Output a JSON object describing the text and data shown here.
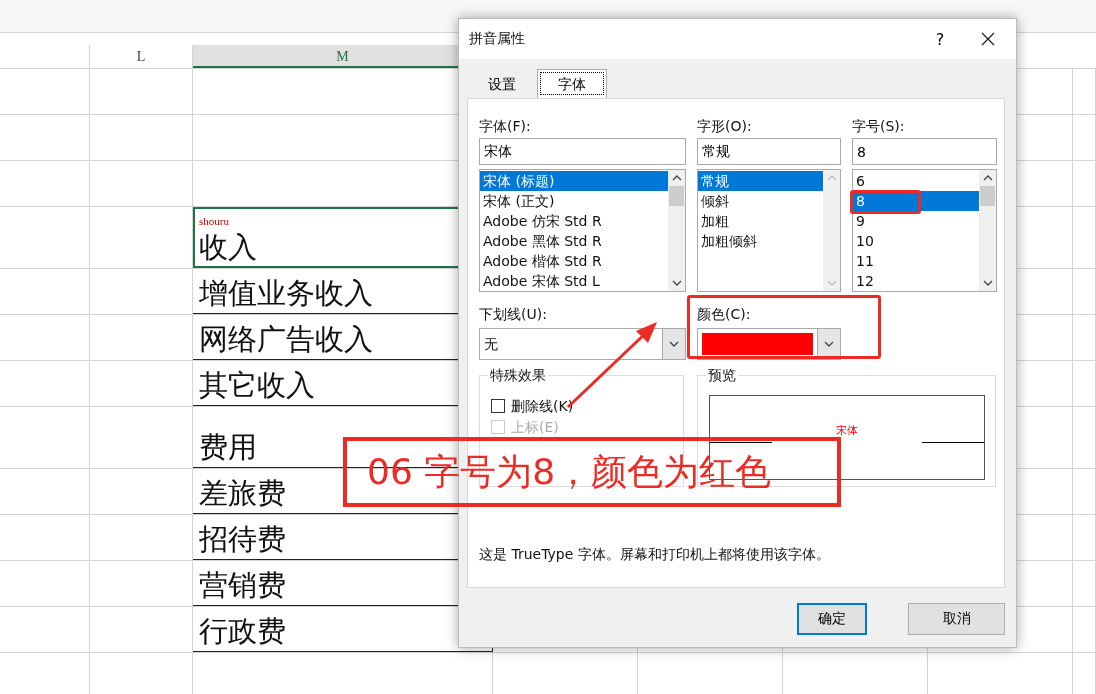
{
  "sheet": {
    "column_headers": [
      {
        "label": "L",
        "selected": false
      },
      {
        "label": "M",
        "selected": true
      }
    ],
    "cells": [
      {
        "phonetic": "shouru",
        "text": "收入",
        "selected": true
      },
      {
        "text": "增值业务收入",
        "selected": false
      },
      {
        "text": "网络广告收入",
        "selected": false
      },
      {
        "text": "其它收入",
        "selected": false
      },
      {
        "text": "费用",
        "selected": false
      },
      {
        "text": "差旅费",
        "selected": false
      },
      {
        "text": "招待费",
        "selected": false
      },
      {
        "text": "营销费",
        "selected": false
      },
      {
        "text": "行政费",
        "selected": false
      }
    ]
  },
  "dialog": {
    "title": "拼音属性",
    "help": "?",
    "tabs": [
      {
        "label": "设置",
        "selected": false
      },
      {
        "label": "字体",
        "selected": true
      }
    ],
    "font": {
      "label": "字体(F):",
      "value": "宋体",
      "items": [
        {
          "label": "宋体 (标题)",
          "selected": true
        },
        {
          "label": "宋体 (正文)",
          "selected": false
        },
        {
          "label": "Adobe 仿宋 Std R",
          "selected": false
        },
        {
          "label": "Adobe 黑体 Std R",
          "selected": false
        },
        {
          "label": "Adobe 楷体 Std R",
          "selected": false
        },
        {
          "label": "Adobe 宋体 Std L",
          "selected": false
        }
      ]
    },
    "style": {
      "label": "字形(O):",
      "value": "常规",
      "items": [
        {
          "label": "常规",
          "selected": true
        },
        {
          "label": "倾斜",
          "selected": false
        },
        {
          "label": "加粗",
          "selected": false
        },
        {
          "label": "加粗倾斜",
          "selected": false
        }
      ]
    },
    "size": {
      "label": "字号(S):",
      "value": "8",
      "items": [
        {
          "label": "6",
          "selected": false
        },
        {
          "label": "8",
          "selected": true
        },
        {
          "label": "9",
          "selected": false
        },
        {
          "label": "10",
          "selected": false
        },
        {
          "label": "11",
          "selected": false
        },
        {
          "label": "12",
          "selected": false
        }
      ]
    },
    "underline": {
      "label": "下划线(U):",
      "value": "无"
    },
    "color": {
      "label": "颜色(C):",
      "color": "#ff0000"
    },
    "effects": {
      "label": "特殊效果",
      "options": [
        {
          "label": "删除线(K)",
          "checked": false,
          "disabled": false
        },
        {
          "label": "上标(E)",
          "checked": false,
          "disabled": true
        }
      ]
    },
    "preview": {
      "label": "预览",
      "sample": "宋体"
    },
    "note": "这是 TrueType 字体。屏幕和打印机上都将使用该字体。",
    "buttons": [
      {
        "label": "确定",
        "default": true
      },
      {
        "label": "取消",
        "default": false
      }
    ]
  },
  "annotation": {
    "text": "06 字号为8，颜色为红色"
  }
}
